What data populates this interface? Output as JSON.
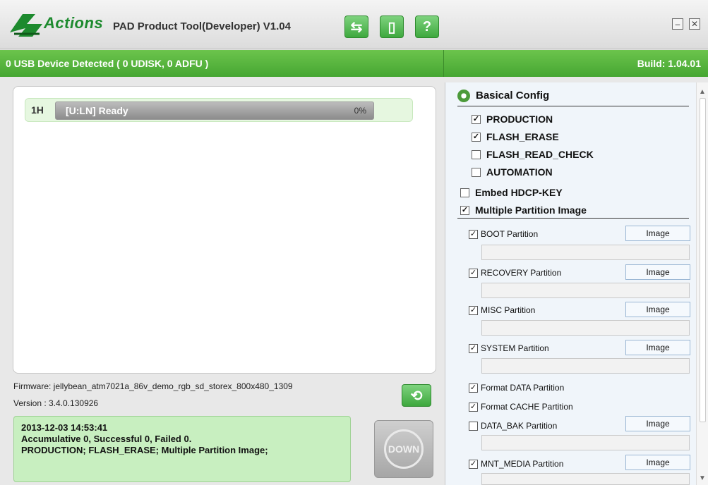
{
  "title_bar": {
    "logo_text": "Actions",
    "app_title": "PAD Product Tool(Developer) V1.04",
    "buttons": [
      {
        "name": "usb-icon",
        "glyph": "⇆"
      },
      {
        "name": "document-icon",
        "glyph": "▯"
      },
      {
        "name": "help-icon",
        "glyph": "?"
      }
    ],
    "window_controls": {
      "minimize": "–",
      "close": "✕"
    }
  },
  "status_bar": {
    "devices_detected": "0 USB Device Detected ( 0 UDISK, 0 ADFU )",
    "build": "Build: 1.04.01"
  },
  "devices": [
    {
      "id": "1H",
      "status": "[U:LN] Ready",
      "progress": "0%",
      "progress_fraction": 0
    }
  ],
  "firmware": {
    "label": "Firmware: jellybean_atm7021a_86v_demo_rgb_sd_storex_800x480_1309",
    "version": "Version : 3.4.0.130926"
  },
  "log": {
    "line1": "2013-12-03 14:53:41",
    "line2": "Accumulative 0, Successful 0, Failed 0.",
    "line3": "PRODUCTION; FLASH_ERASE; Multiple Partition Image;"
  },
  "down_button": {
    "label": "DOWN"
  },
  "config": {
    "section_title": "Basical Config",
    "basic_options": [
      {
        "label": "PRODUCTION",
        "checked": true
      },
      {
        "label": "FLASH_ERASE",
        "checked": true
      },
      {
        "label": "FLASH_READ_CHECK",
        "checked": false
      },
      {
        "label": "AUTOMATION",
        "checked": false
      }
    ],
    "embed_hdcp": {
      "label": "Embed HDCP-KEY",
      "checked": false
    },
    "multi_partition": {
      "label": "Multiple Partition Image",
      "checked": true
    },
    "partitions": [
      {
        "label": "BOOT Partition",
        "checked": true,
        "has_image": true,
        "image_label": "Image"
      },
      {
        "label": "RECOVERY Partition",
        "checked": true,
        "has_image": true,
        "image_label": "Image"
      },
      {
        "label": "MISC Partition",
        "checked": true,
        "has_image": true,
        "image_label": "Image"
      },
      {
        "label": "SYSTEM Partition",
        "checked": true,
        "has_image": true,
        "image_label": "Image"
      },
      {
        "label": "Format DATA Partition",
        "checked": true,
        "has_image": false
      },
      {
        "label": "Format CACHE Partition",
        "checked": true,
        "has_image": false
      },
      {
        "label": "DATA_BAK Partition",
        "checked": false,
        "has_image": true,
        "image_label": "Image"
      },
      {
        "label": "MNT_MEDIA Partition",
        "checked": true,
        "has_image": true,
        "image_label": "Image"
      }
    ]
  },
  "colors": {
    "brand_green": "#45a632",
    "log_bg": "#c8efc0",
    "config_bg": "#f0f5fa"
  }
}
